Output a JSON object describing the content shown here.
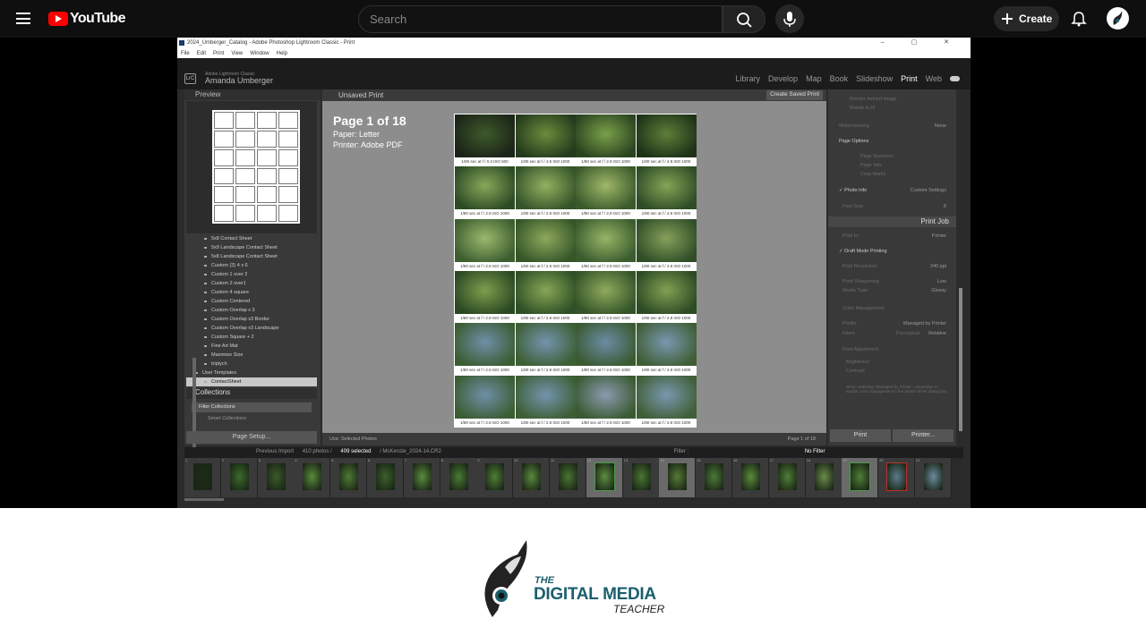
{
  "youtube": {
    "logo_text": "YouTube",
    "search_placeholder": "Search",
    "create_label": "Create"
  },
  "window": {
    "title": "2024_Umberger_Catalog - Adobe Photoshop Lightroom Classic - Print",
    "controls": "– ▢ ✕",
    "menu": [
      "File",
      "Edit",
      "Print",
      "View",
      "Window",
      "Help"
    ]
  },
  "lightroom": {
    "badge": "LrC",
    "app_small": "Adobe Lightroom Classic",
    "user": "Amanda Umberger",
    "modules": [
      "Library",
      "Develop",
      "Map",
      "Book",
      "Slideshow",
      "Print",
      "Web"
    ],
    "active_module": "Print"
  },
  "left_panel": {
    "preview_label": "Preview",
    "templates": [
      "5x8 Contact Sheet",
      "5x9 Landscape Contact Sheet",
      "5x8 Landscape Contact Sheet",
      "Custom (3) 4 x 6",
      "Custom 1 over 2",
      "Custom 2 over1",
      "Custom 4 square",
      "Custom Centered",
      "Custom Overlap x 3",
      "Custom Overlap x3 Border",
      "Custom Overlap x3 Landscape",
      "Custom Square + 2",
      "Fine Art Mat",
      "Maximize Size",
      "triptych"
    ],
    "user_templates_label": "User Templates",
    "selected_template": "ContactSheet",
    "collections_label": "Collections",
    "filter_collections": "Filter Collections",
    "smart_collections": "Smart Collections",
    "page_setup_label": "Page Setup..."
  },
  "center": {
    "unsaved_label": "Unsaved Print",
    "create_saved_label": "Create Saved Print",
    "page_title": "Page 1 of 18",
    "paper": "Paper:  Letter",
    "printer": "Printer:  Adobe PDF",
    "captions": [
      "1/80 sec at f / 0.3 ISO 500",
      "1/80 sec at f / 4.5 ISO 1000",
      "1/80 sec at f / 2.8 ISO 1000",
      "1/80 sec at f / 2.8 ISO 1000",
      "1/80 sec at f / 2.8 ISO 1000",
      "1/80 sec at f / 2.8 ISO 1000",
      "1/80 sec at f / 2.8 ISO 1000",
      "1/80 sec at f / 2.8 ISO 1000",
      "1/80 sec at f / 2.8 ISO 1000",
      "1/80 sec at f / 2.8 ISO 1000",
      "1/80 sec at f / 2.8 ISO 1000",
      "1/80 sec at f / 2.8 ISO 1000",
      "1/80 sec at f / 2.8 ISO 1000",
      "1/80 sec at f / 2.8 ISO 1000",
      "1/80 sec at f / 2.8 ISO 1000",
      "1/80 sec at f / 2.8 ISO 1000",
      "1/80 sec at f / 2.8 ISO 1000",
      "1/80 sec at f / 2.8 ISO 1000",
      "1/80 sec at f / 2.8 ISO 1000",
      "1/80 sec at f / 2.8 ISO 1000",
      "1/80 sec at f / 2.8 ISO 1000",
      "1/80 sec at f / 2.8 ISO 1000",
      "1/80 sec at f / 2.8 ISO 1000",
      "1/80 sec at f / 2.8 ISO 1000"
    ],
    "use_label": "Use:",
    "use_value": "Selected Photos",
    "page_count": "Page 1 of 18"
  },
  "right_panel": {
    "render_behind": "Render behind image",
    "rotate_fit": "Rotate to fit",
    "watermarking": "Watermarking",
    "watermark_value": "None",
    "page_options": "Page Options",
    "page_numbers": "Page Numbers",
    "page_info": "Page Info",
    "crop_marks": "Crop Marks",
    "photo_info": "Photo Info",
    "photo_info_value": "Custom Settings",
    "font_size": "Font Size",
    "font_size_value": "8",
    "print_job": "Print Job",
    "print_to": "Print to:",
    "print_to_value": "Printer",
    "draft_mode": "Draft Mode Printing",
    "print_resolution": "Print Resolution",
    "resolution_value": "240 ppi",
    "print_sharpening": "Print Sharpening",
    "sharpening_value": "Low",
    "media_type": "Media Type",
    "media_value": "Glossy",
    "color_management": "Color Management",
    "profile": "Profile",
    "profile_value": "Managed by Printer",
    "intent": "Intent",
    "perceptual": "Perceptual",
    "relative": "Relative",
    "print_adjustment": "Print Adjustment",
    "brightness": "Brightness",
    "contrast": "Contrast",
    "info_note": "When selecting \"Managed by Printer\", remember to enable color management in the printer driver dialog box.",
    "print_btn": "Print",
    "printer_btn": "Printer..."
  },
  "filmstrip": {
    "previous_import": "Previous Import",
    "photo_count": "410 photos /",
    "selected": "409 selected",
    "file": "/ McKenzie_2024-14.CR2",
    "filter_label": "Filter :",
    "no_filter": "No Filter",
    "numbers": [
      "1",
      "2",
      "3",
      "4",
      "5",
      "6",
      "7",
      "8",
      "9",
      "10",
      "11",
      "12",
      "13",
      "14",
      "15",
      "16",
      "17",
      "18",
      "19",
      "20",
      "21"
    ]
  },
  "brand": {
    "the": "THE",
    "digital_media": "DIGITAL MEDIA",
    "teacher": "TEACHER"
  },
  "colors": {
    "youtube_red": "#ff0000",
    "brand_teal": "#1c5f6e"
  }
}
